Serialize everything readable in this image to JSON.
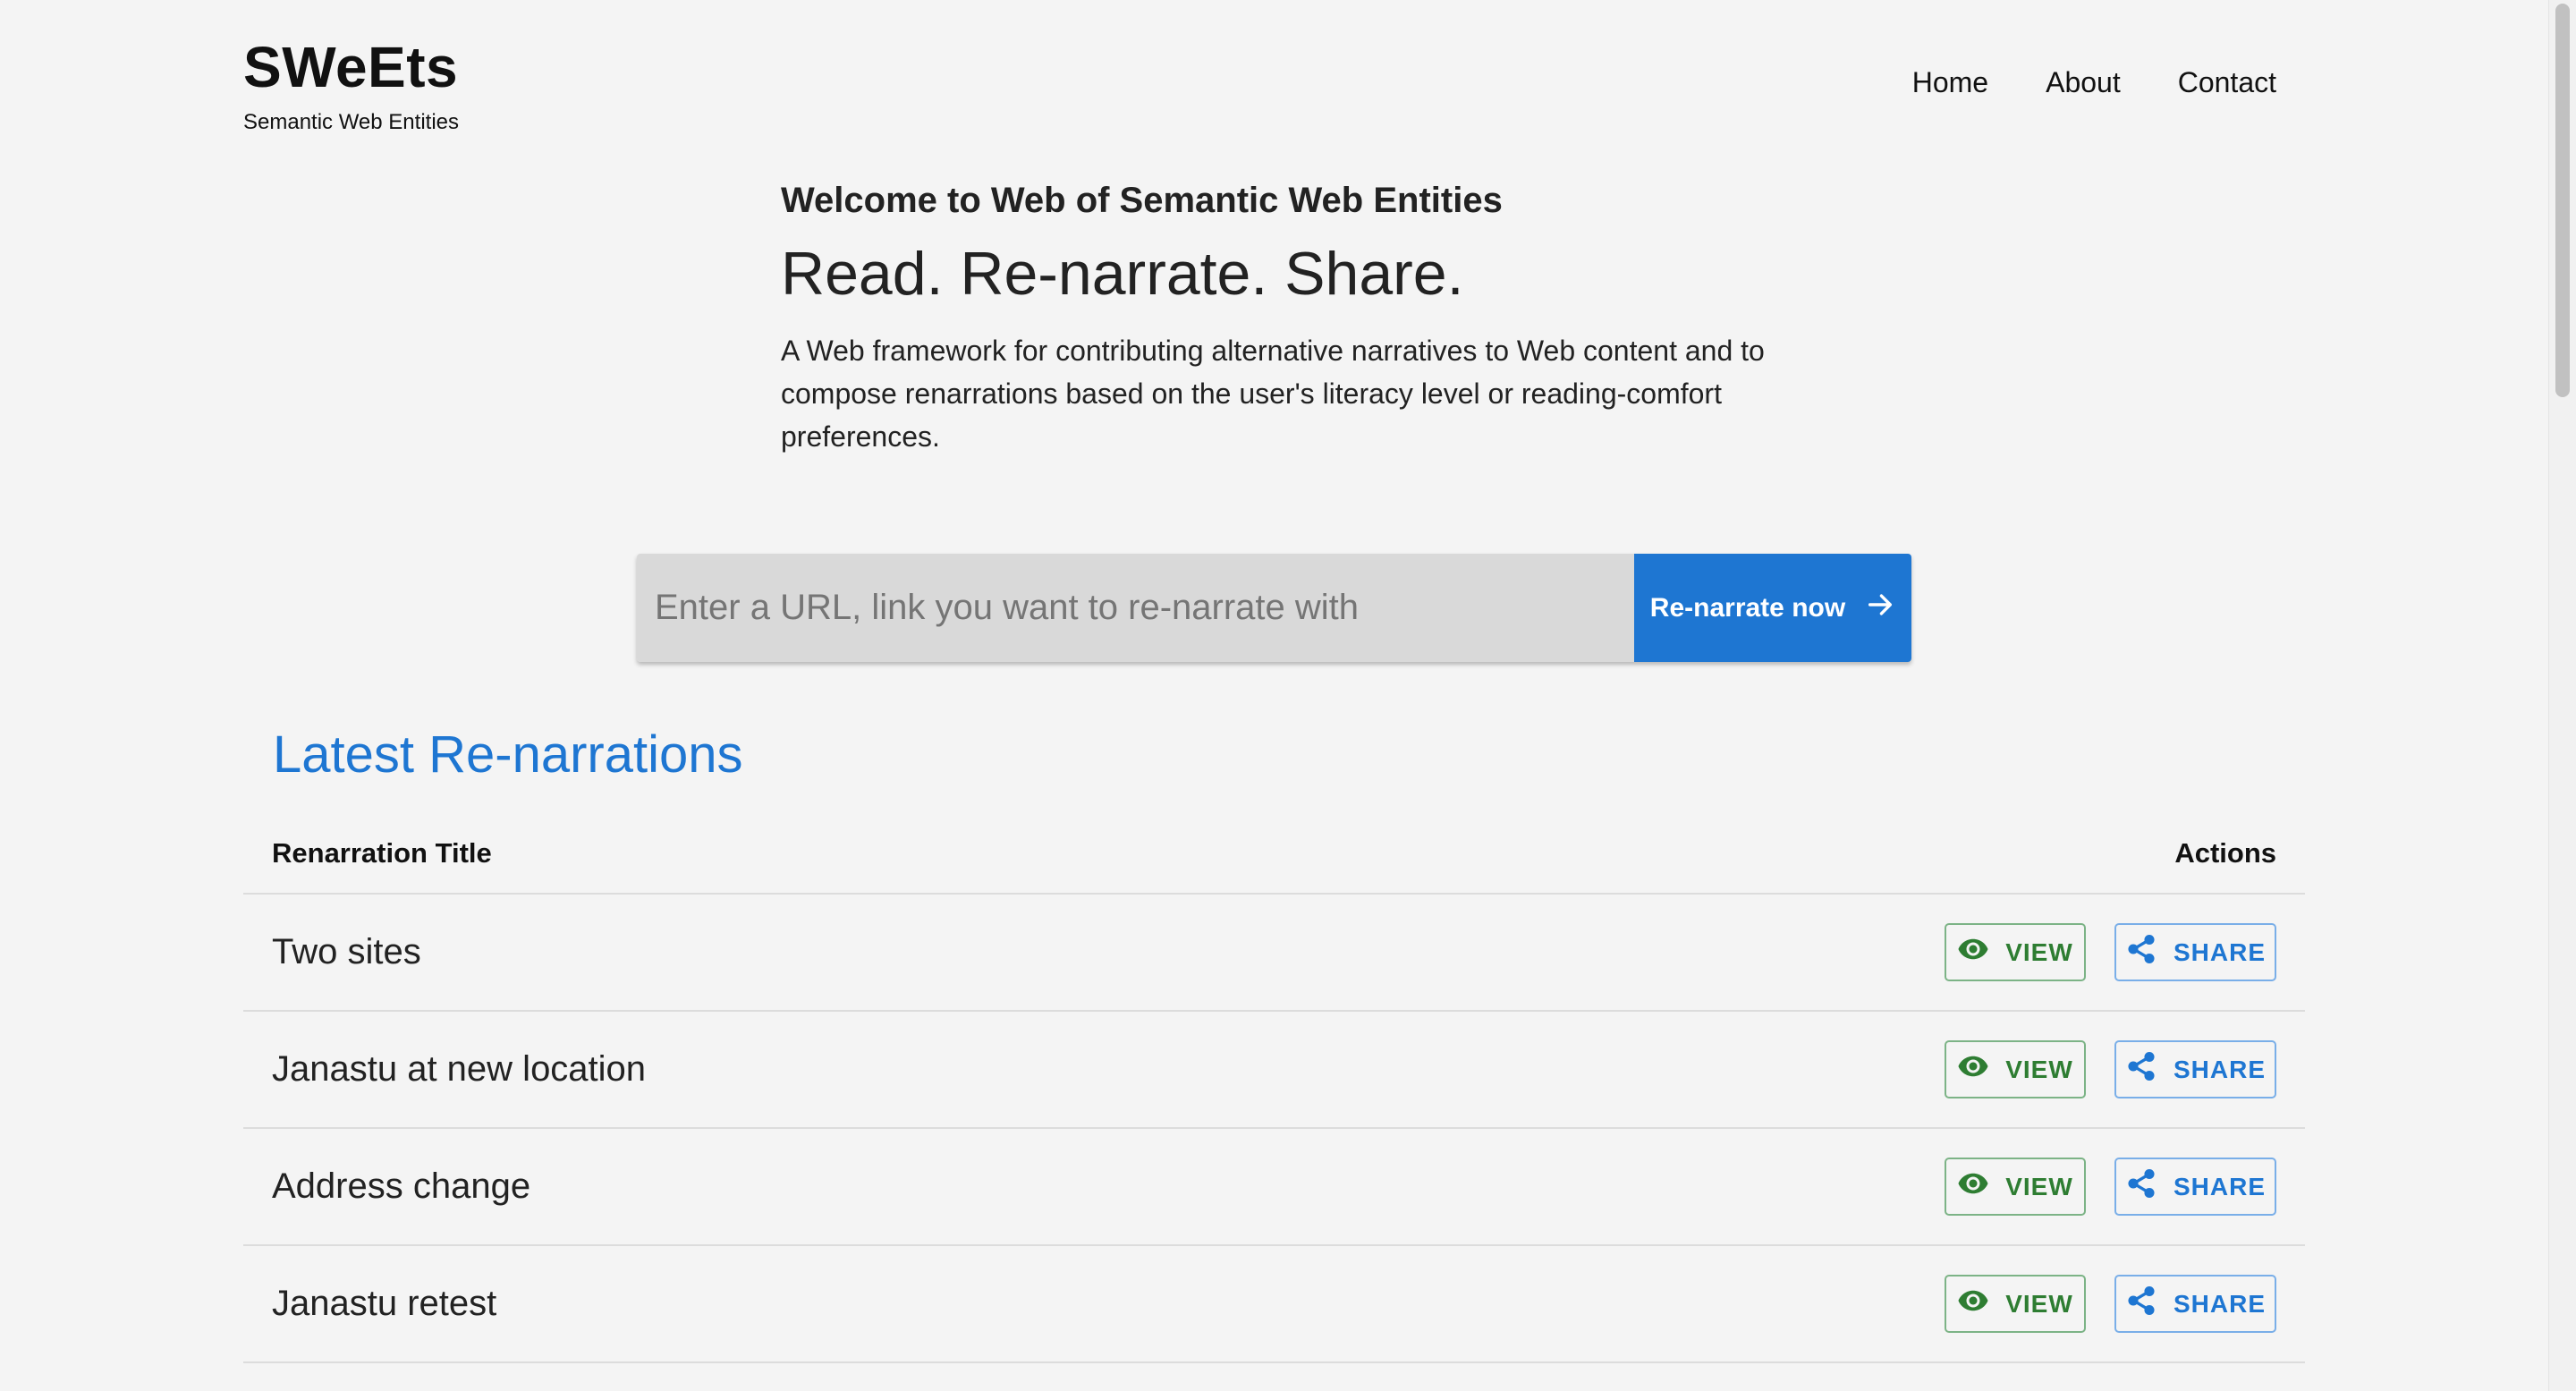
{
  "header": {
    "brand_title": "SWeEts",
    "brand_subtitle": "Semantic Web Entities",
    "nav": [
      "Home",
      "About",
      "Contact"
    ]
  },
  "hero": {
    "welcome": "Welcome to Web of Semantic Web Entities",
    "tagline": "Read. Re-narrate. Share.",
    "description": "A Web framework for contributing alternative narratives to Web content and to compose renarrations based on the user's literacy level or reading-comfort preferences."
  },
  "search": {
    "placeholder": "Enter a URL, link you want to re-narrate with",
    "value": "",
    "button_label": "Re-narrate now",
    "button_icon": "arrow-right-icon"
  },
  "latest": {
    "section_title": "Latest Re-narrations",
    "columns": [
      "Renarration Title",
      "Actions"
    ],
    "view_label": "VIEW",
    "share_label": "SHARE",
    "rows": [
      {
        "title": "Two sites"
      },
      {
        "title": "Janastu at new location"
      },
      {
        "title": "Address change"
      },
      {
        "title": "Janastu retest"
      }
    ]
  },
  "colors": {
    "primary": "#1e76d2",
    "view": "#2e7d32",
    "background": "#f4f4f4"
  }
}
